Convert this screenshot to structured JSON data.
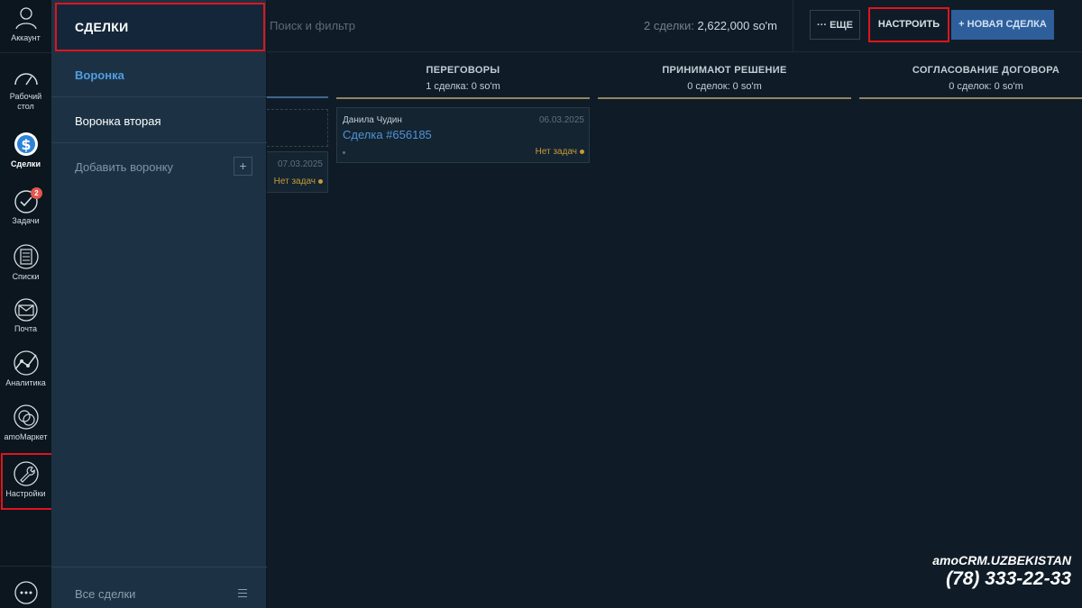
{
  "sidebar": {
    "items": [
      {
        "label": "Аккаунт",
        "icon": "account-avatar-icon"
      },
      {
        "label": "Рабочий стол",
        "icon": "dashboard-icon"
      },
      {
        "label": "Сделки",
        "icon": "deals-dollar-icon"
      },
      {
        "label": "Задачи",
        "icon": "tasks-check-icon",
        "badge": "2"
      },
      {
        "label": "Списки",
        "icon": "lists-icon"
      },
      {
        "label": "Почта",
        "icon": "mail-icon"
      },
      {
        "label": "Аналитика",
        "icon": "analytics-icon"
      },
      {
        "label": "amoМаркет",
        "icon": "market-icon"
      },
      {
        "label": "Настройки",
        "icon": "settings-wrench-icon"
      }
    ],
    "chat_icon": "chat-icon"
  },
  "pipeline_panel": {
    "title": "СДЕЛКИ",
    "items": [
      "Воронка",
      "Воронка вторая",
      "Добавить воронку"
    ],
    "add_symbol": "+",
    "footer": "Все сделки",
    "footer_icon": "menu-lines-icon"
  },
  "topbar": {
    "search_placeholder": "Поиск и фильтр",
    "summary_count": "2 сделки:",
    "summary_amount": "2,622,000 so'm",
    "more_label": "··· ЕЩЕ",
    "config_label": "НАСТРОИТЬ",
    "new_deal_label": "+ НОВАЯ СДЕЛКА"
  },
  "columns": [
    {
      "name": "ПЕРЕГОВОРЫ",
      "count": "1 сделка: 0 so'm",
      "color": "#8e8760"
    },
    {
      "name": "ПРИНИМАЮТ РЕШЕНИЕ",
      "count": "0 сделок: 0 so'm",
      "color": "#8e8760"
    },
    {
      "name": "СОГЛАСОВАНИЕ ДОГОВОРА",
      "count": "0 сделок: 0 so'm",
      "color": "#8e8760"
    }
  ],
  "first_column_line_color": "#3f6790",
  "cards": [
    {
      "contact": "Данила Чудин",
      "date": "06.03.2025",
      "deal": "Сделка #656185",
      "tasks": "Нет задач"
    },
    {
      "date": "07.03.2025",
      "tasks": "Нет задач"
    }
  ],
  "brand": {
    "line1": "amoCRM.UZBEKISTAN",
    "phone": "(78) 333-22-33"
  }
}
